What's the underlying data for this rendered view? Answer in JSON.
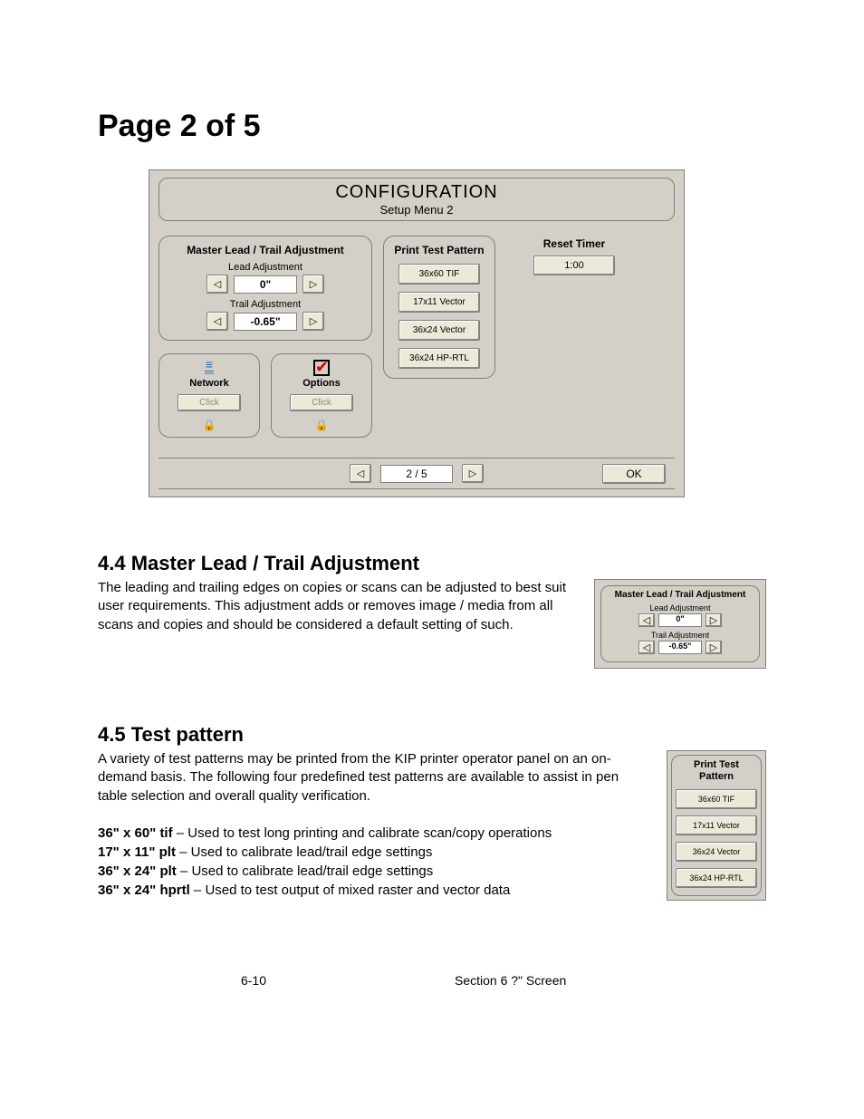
{
  "page_heading": "Page 2 of 5",
  "config": {
    "title": "CONFIGURATION",
    "subtitle": "Setup Menu 2",
    "master": {
      "title": "Master Lead / Trail Adjustment",
      "lead_label": "Lead Adjustment",
      "lead_value": "0\"",
      "trail_label": "Trail Adjustment",
      "trail_value": "-0.65\""
    },
    "print_test": {
      "title": "Print Test Pattern",
      "buttons": [
        "36x60 TIF",
        "17x11 Vector",
        "36x24 Vector",
        "36x24 HP-RTL"
      ]
    },
    "reset": {
      "title": "Reset Timer",
      "value": "1:00"
    },
    "network": {
      "label": "Network",
      "click": "Click"
    },
    "options": {
      "label": "Options",
      "click": "Click"
    },
    "footer": {
      "page": "2 / 5",
      "ok": "OK"
    }
  },
  "sec44": {
    "heading": "4.4   Master Lead / Trail Adjustment",
    "body": "The leading and trailing edges on copies or scans can be adjusted to best suit user requirements. This adjustment adds or removes image / media from all scans and copies and should be considered a default setting of such.",
    "mini": {
      "title": "Master Lead / Trail Adjustment",
      "lead_label": "Lead Adjustment",
      "lead_value": "0\"",
      "trail_label": "Trail Adjustment",
      "trail_value": "-0.65\""
    }
  },
  "sec45": {
    "heading": "4.5  Test pattern",
    "body": "A variety of test patterns may be printed from the KIP printer operator panel on an on-demand basis.  The following four predefined test patterns are available to assist in pen table selection and overall quality verification.",
    "items": [
      {
        "b": "36\" x 60\" tif",
        "t": " – Used to test long printing and calibrate scan/copy operations"
      },
      {
        "b": "17\" x 11\" plt",
        "t": " – Used to calibrate lead/trail edge settings"
      },
      {
        "b": "36\" x 24\" plt",
        "t": " – Used to calibrate lead/trail edge settings"
      },
      {
        "b": "36\" x 24\" hprtl",
        "t": " – Used to test output of mixed raster and vector data"
      }
    ],
    "mini": {
      "title": "Print Test Pattern",
      "buttons": [
        "36x60 TIF",
        "17x11 Vector",
        "36x24 Vector",
        "36x24 HP-RTL"
      ]
    }
  },
  "footer": {
    "left": "6-10",
    "right": "Section 6    ?\" Screen"
  }
}
